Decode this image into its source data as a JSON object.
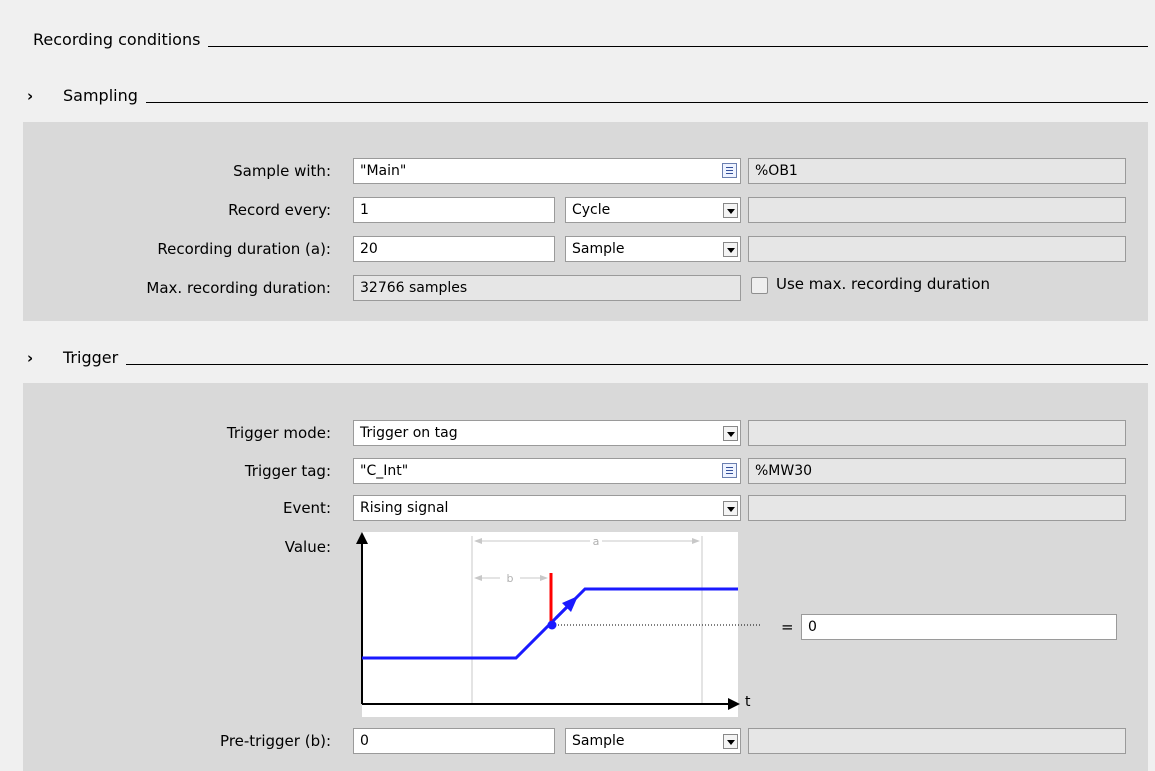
{
  "header": {
    "title": "Recording conditions"
  },
  "sampling": {
    "title": "Sampling",
    "chevron": "›",
    "sample_with_label": "Sample with:",
    "sample_with_value": "\"Main\"",
    "sample_with_address": "%OB1",
    "record_every_label": "Record every:",
    "record_every_value": "1",
    "record_every_unit": "Cycle",
    "recording_duration_label": "Recording duration (a):",
    "recording_duration_value": "20",
    "recording_duration_unit": "Sample",
    "max_duration_label": "Max. recording duration:",
    "max_duration_value": "32766 samples",
    "use_max_label": "Use max. recording duration",
    "use_max_checked": false
  },
  "trigger": {
    "title": "Trigger",
    "chevron": "›",
    "mode_label": "Trigger mode:",
    "mode_value": "Trigger on tag",
    "tag_label": "Trigger tag:",
    "tag_value": "\"C_Int\"",
    "tag_address": "%MW30",
    "event_label": "Event:",
    "event_value": "Rising signal",
    "value_label": "Value:",
    "value_equals": "=",
    "value_input": "0",
    "pretrigger_label": "Pre-trigger (b):",
    "pretrigger_value": "0",
    "pretrigger_unit": "Sample",
    "diagram": {
      "a_label": "a",
      "b_label": "b",
      "t_label": "t"
    }
  },
  "colors": {
    "signal": "#1a1aff",
    "trigger_marker": "#ff0000",
    "panel": "#d9d9d9"
  }
}
